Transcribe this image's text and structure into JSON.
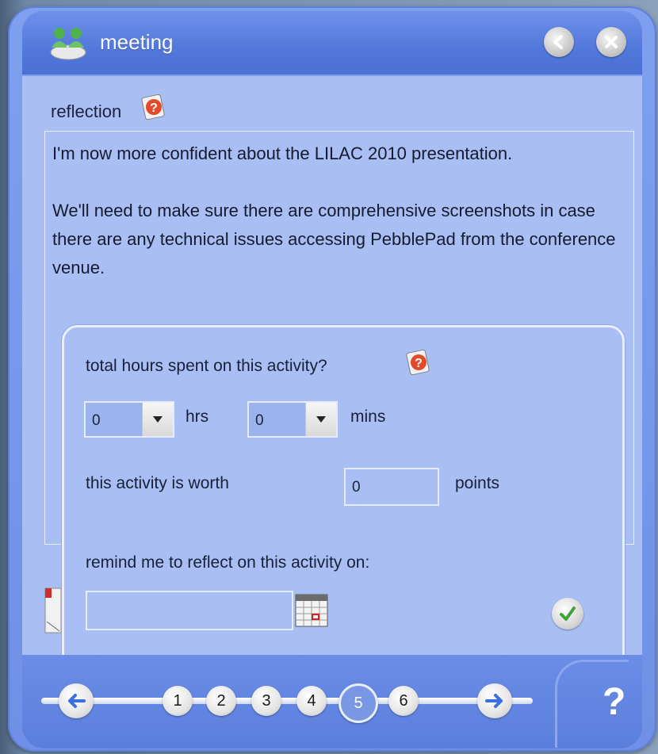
{
  "window": {
    "title": "meeting"
  },
  "reflection": {
    "label": "reflection",
    "text": "I'm now more confident about the LILAC 2010 presentation.\n\nWe'll need to make sure there are comprehensive screenshots in case there are any technical issues accessing PebblePad from the conference venue."
  },
  "time_panel": {
    "prompt": "total hours spent on this activity?",
    "hours_value": "0",
    "hours_unit": "hrs",
    "minutes_value": "0",
    "minutes_unit": "mins",
    "worth_label": "this activity is worth",
    "points_value": "0",
    "points_unit": "points",
    "remind_label": "remind me to reflect on this activity on:",
    "remind_date": ""
  },
  "pagination": {
    "pages": [
      "1",
      "2",
      "3",
      "4",
      "5",
      "6"
    ],
    "current_page": "5"
  },
  "footer": {
    "help_label": "?"
  },
  "colors": {
    "panel": "#a9bff4",
    "titlebar": "#5278db",
    "accent_arrow": "#3a6fe0"
  },
  "icons": [
    "users-icon",
    "back-icon",
    "close-icon",
    "help-icon",
    "calendar-icon",
    "confirm-icon",
    "prev-arrow-icon",
    "next-arrow-icon"
  ]
}
